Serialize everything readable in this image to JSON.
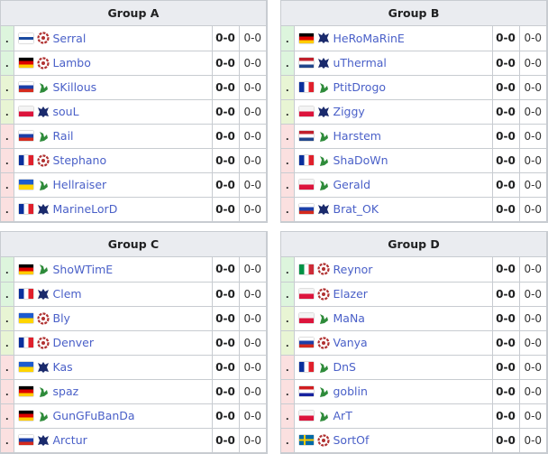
{
  "groups": [
    {
      "title": "Group A",
      "rows": [
        {
          "rank": ".",
          "status": "up",
          "flag": "fi",
          "race": "zerg",
          "name": "Serral",
          "score": "0-0",
          "score2": "0-0"
        },
        {
          "rank": ".",
          "status": "up",
          "flag": "de",
          "race": "zerg",
          "name": "Lambo",
          "score": "0-0",
          "score2": "0-0"
        },
        {
          "rank": ".",
          "status": "mid",
          "flag": "ru",
          "race": "protoss",
          "name": "SKillous",
          "score": "0-0",
          "score2": "0-0"
        },
        {
          "rank": ".",
          "status": "mid",
          "flag": "pl",
          "race": "terran",
          "name": "souL",
          "score": "0-0",
          "score2": "0-0"
        },
        {
          "rank": ".",
          "status": "out",
          "flag": "ru",
          "race": "protoss",
          "name": "Rail",
          "score": "0-0",
          "score2": "0-0"
        },
        {
          "rank": ".",
          "status": "out",
          "flag": "fr",
          "race": "zerg",
          "name": "Stephano",
          "score": "0-0",
          "score2": "0-0"
        },
        {
          "rank": ".",
          "status": "out",
          "flag": "ua",
          "race": "protoss",
          "name": "Hellraiser",
          "score": "0-0",
          "score2": "0-0"
        },
        {
          "rank": ".",
          "status": "out",
          "flag": "fr",
          "race": "terran",
          "name": "MarineLorD",
          "score": "0-0",
          "score2": "0-0"
        }
      ]
    },
    {
      "title": "Group B",
      "rows": [
        {
          "rank": ".",
          "status": "up",
          "flag": "de",
          "race": "terran",
          "name": "HeRoMaRinE",
          "score": "0-0",
          "score2": "0-0"
        },
        {
          "rank": ".",
          "status": "up",
          "flag": "nl",
          "race": "terran",
          "name": "uThermal",
          "score": "0-0",
          "score2": "0-0"
        },
        {
          "rank": ".",
          "status": "mid",
          "flag": "fr",
          "race": "protoss",
          "name": "PtitDrogo",
          "score": "0-0",
          "score2": "0-0"
        },
        {
          "rank": ".",
          "status": "mid",
          "flag": "pl",
          "race": "terran",
          "name": "Ziggy",
          "score": "0-0",
          "score2": "0-0"
        },
        {
          "rank": ".",
          "status": "out",
          "flag": "nl",
          "race": "protoss",
          "name": "Harstem",
          "score": "0-0",
          "score2": "0-0"
        },
        {
          "rank": ".",
          "status": "out",
          "flag": "fr",
          "race": "protoss",
          "name": "ShaDoWn",
          "score": "0-0",
          "score2": "0-0"
        },
        {
          "rank": ".",
          "status": "out",
          "flag": "pl",
          "race": "protoss",
          "name": "Gerald",
          "score": "0-0",
          "score2": "0-0"
        },
        {
          "rank": ".",
          "status": "out",
          "flag": "ru",
          "race": "terran",
          "name": "Brat_OK",
          "score": "0-0",
          "score2": "0-0"
        }
      ]
    },
    {
      "title": "Group C",
      "rows": [
        {
          "rank": ".",
          "status": "up",
          "flag": "de",
          "race": "protoss",
          "name": "ShoWTimE",
          "score": "0-0",
          "score2": "0-0"
        },
        {
          "rank": ".",
          "status": "up",
          "flag": "fr",
          "race": "terran",
          "name": "Clem",
          "score": "0-0",
          "score2": "0-0"
        },
        {
          "rank": ".",
          "status": "mid",
          "flag": "ua",
          "race": "zerg",
          "name": "Bly",
          "score": "0-0",
          "score2": "0-0"
        },
        {
          "rank": ".",
          "status": "mid",
          "flag": "fr",
          "race": "zerg",
          "name": "Denver",
          "score": "0-0",
          "score2": "0-0"
        },
        {
          "rank": ".",
          "status": "out",
          "flag": "ua",
          "race": "terran",
          "name": "Kas",
          "score": "0-0",
          "score2": "0-0"
        },
        {
          "rank": ".",
          "status": "out",
          "flag": "de",
          "race": "protoss",
          "name": "spaz",
          "score": "0-0",
          "score2": "0-0"
        },
        {
          "rank": ".",
          "status": "out",
          "flag": "de",
          "race": "protoss",
          "name": "GunGFuBanDa",
          "score": "0-0",
          "score2": "0-0"
        },
        {
          "rank": ".",
          "status": "out",
          "flag": "ru",
          "race": "terran",
          "name": "Arctur",
          "score": "0-0",
          "score2": "0-0"
        }
      ]
    },
    {
      "title": "Group D",
      "rows": [
        {
          "rank": ".",
          "status": "up",
          "flag": "it",
          "race": "zerg",
          "name": "Reynor",
          "score": "0-0",
          "score2": "0-0"
        },
        {
          "rank": ".",
          "status": "up",
          "flag": "pl",
          "race": "zerg",
          "name": "Elazer",
          "score": "0-0",
          "score2": "0-0"
        },
        {
          "rank": ".",
          "status": "mid",
          "flag": "pl",
          "race": "protoss",
          "name": "MaNa",
          "score": "0-0",
          "score2": "0-0"
        },
        {
          "rank": ".",
          "status": "mid",
          "flag": "ru",
          "race": "zerg",
          "name": "Vanya",
          "score": "0-0",
          "score2": "0-0"
        },
        {
          "rank": ".",
          "status": "out",
          "flag": "fr",
          "race": "protoss",
          "name": "DnS",
          "score": "0-0",
          "score2": "0-0"
        },
        {
          "rank": ".",
          "status": "out",
          "flag": "hr",
          "race": "protoss",
          "name": "goblin",
          "score": "0-0",
          "score2": "0-0"
        },
        {
          "rank": ".",
          "status": "out",
          "flag": "pl",
          "race": "protoss",
          "name": "ArT",
          "score": "0-0",
          "score2": "0-0"
        },
        {
          "rank": ".",
          "status": "out",
          "flag": "se",
          "race": "zerg",
          "name": "SortOf",
          "score": "0-0",
          "score2": "0-0"
        }
      ]
    }
  ],
  "colors": {
    "up": "#ddf5dd",
    "mid": "#e8f5d4",
    "out": "#fbe0e0",
    "link": "#4a60c8",
    "header": "#eaecf0"
  }
}
